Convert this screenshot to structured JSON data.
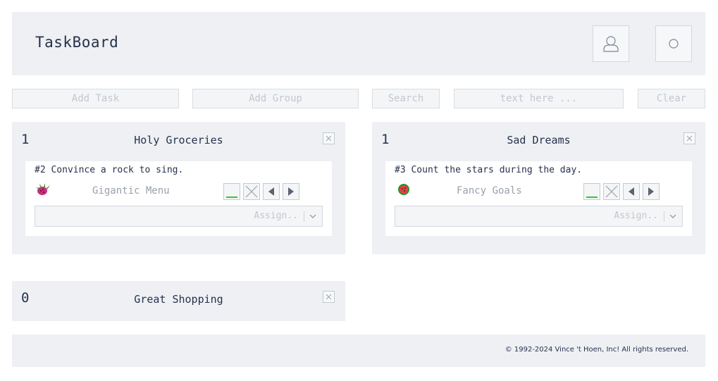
{
  "header": {
    "title": "TaskBoard",
    "user_icon": "user-icon",
    "settings_icon": "circle-icon"
  },
  "toolbar": {
    "add_task": "Add Task",
    "add_group": "Add Group",
    "search": "Search",
    "search_placeholder": "text here ...",
    "clear": "Clear"
  },
  "groups": [
    {
      "count": "1",
      "title": "Holy Groceries",
      "task": {
        "title": "#2 Convince a rock to sing.",
        "emoji_icon": "dragon-fruit-icon",
        "subgroup": "Gigantic Menu",
        "assign_placeholder": "Assign.."
      }
    },
    {
      "count": "1",
      "title": "Sad Dreams",
      "task": {
        "title": "#3 Count the stars during the day.",
        "emoji_icon": "watermelon-icon",
        "subgroup": "Fancy Goals",
        "assign_placeholder": "Assign.."
      }
    },
    {
      "count": "0",
      "title": "Great Shopping"
    }
  ],
  "footer": {
    "copyright": "© 1992-2024 Vince 't Hoen, Inc! All rights reserved."
  },
  "colors": {
    "panel": "#eef0f3",
    "text": "#26324d",
    "muted": "#c2c7cf",
    "complete_green": "#3ec43e"
  }
}
